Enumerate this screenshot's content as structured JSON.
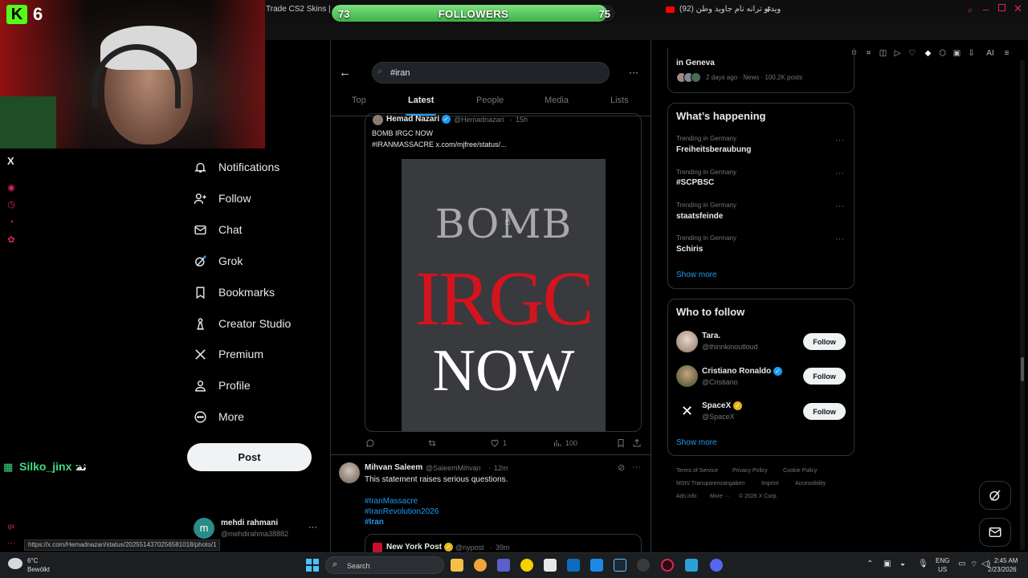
{
  "browser": {
    "tab_trade": "Trade CS2 Skins | Be",
    "tab_youtube": "(92) ویدئو ترانه نام جاوید وطن",
    "new_tab": "+",
    "ai_label": "AI"
  },
  "stream": {
    "viewers": "6",
    "followers_label": "FOLLOWERS",
    "followers_current": "73",
    "followers_goal": "75",
    "followers_progress": 0.973,
    "chat_user": "Silko_jinx :",
    "chat_message": "ثة"
  },
  "x_nav": {
    "logo": "X",
    "items": [
      {
        "label": "Notifications",
        "icon": "bell-icon"
      },
      {
        "label": "Follow",
        "icon": "person-plus-icon"
      },
      {
        "label": "Chat",
        "icon": "envelope-icon"
      },
      {
        "label": "Grok",
        "icon": "grok-icon"
      },
      {
        "label": "Bookmarks",
        "icon": "bookmark-icon"
      },
      {
        "label": "Creator Studio",
        "icon": "creator-studio-icon"
      },
      {
        "label": "Premium",
        "icon": "x-logo-icon"
      },
      {
        "label": "Profile",
        "icon": "person-icon"
      },
      {
        "label": "More",
        "icon": "more-circle-icon"
      }
    ],
    "post_label": "Post",
    "account_name": "mehdi rahmani",
    "account_handle": "@mehdirahma38882",
    "account_initial": "m",
    "account_more": "···"
  },
  "search": {
    "query": "#iran",
    "more": "···",
    "tabs": [
      "Top",
      "Latest",
      "People",
      "Media",
      "Lists"
    ],
    "active_tab": "Latest"
  },
  "tweet1": {
    "author": "Hemad Nazari",
    "handle": "@Hemadnazari",
    "time": "15h",
    "text_line1": "BOMB IRGC NOW",
    "text_line2": "#IRANMASSACRE x.com/mjfree/status/...",
    "image_words": [
      "BOMB",
      "IRGC",
      "NOW"
    ],
    "likes": "1",
    "views": "100"
  },
  "tweet2": {
    "author": "Mihvan Saleem",
    "handle": "@SaleemMihvan",
    "time": "12m",
    "text": "This statement raises serious questions.",
    "hashtags": [
      "#IranMassacre",
      "#IranRevolution2026",
      "#Iran"
    ],
    "quoted_author": "New York Post",
    "quoted_handle": "@nypost",
    "quoted_time": "39m",
    "more": "···"
  },
  "right": {
    "top_news_title": "in Geneva",
    "top_news_meta": "2 days ago · News · 100.2K posts",
    "whats_happening": "What’s happening",
    "trends": [
      {
        "context": "Trending in Germany",
        "name": "Freiheitsberaubung"
      },
      {
        "context": "Trending in Germany",
        "name": "#SCPBSC"
      },
      {
        "context": "Trending in Germany",
        "name": "staatsfeinde"
      },
      {
        "context": "Trending in Germany",
        "name": "Schiris"
      }
    ],
    "trend_more": "···",
    "show_more": "Show more",
    "who_to_follow": "Who to follow",
    "who": [
      {
        "name": "Tara.",
        "handle": "@thinnkinoutloud",
        "follow": "Follow"
      },
      {
        "name": "Cristiano Ronaldo",
        "handle": "@Cristiano",
        "follow": "Follow"
      },
      {
        "name": "SpaceX",
        "handle": "@SpaceX",
        "follow": "Follow"
      }
    ],
    "show_more2": "Show more",
    "footer": [
      "Terms of Service",
      "Privacy Policy",
      "Cookie Policy",
      "MStV Transparenzangaben",
      "Imprint",
      "Accessibility",
      "Ads info",
      "More ···",
      "© 2026 X Corp."
    ]
  },
  "status_url": "https://x.com/Hemadnazari/status/2025514370256581018/photo/1",
  "taskbar": {
    "weather_temp": "6°C",
    "weather_desc": "Bewölkt",
    "search": "Search",
    "lang1": "ENG",
    "lang2": "US",
    "time": "2:45 AM",
    "date": "2/23/2026"
  },
  "colors": {
    "accent": "#1d9bf0",
    "irgc_red": "#d3141e",
    "followers_green": "#3eb24a",
    "chat_green": "#3ddc84"
  }
}
